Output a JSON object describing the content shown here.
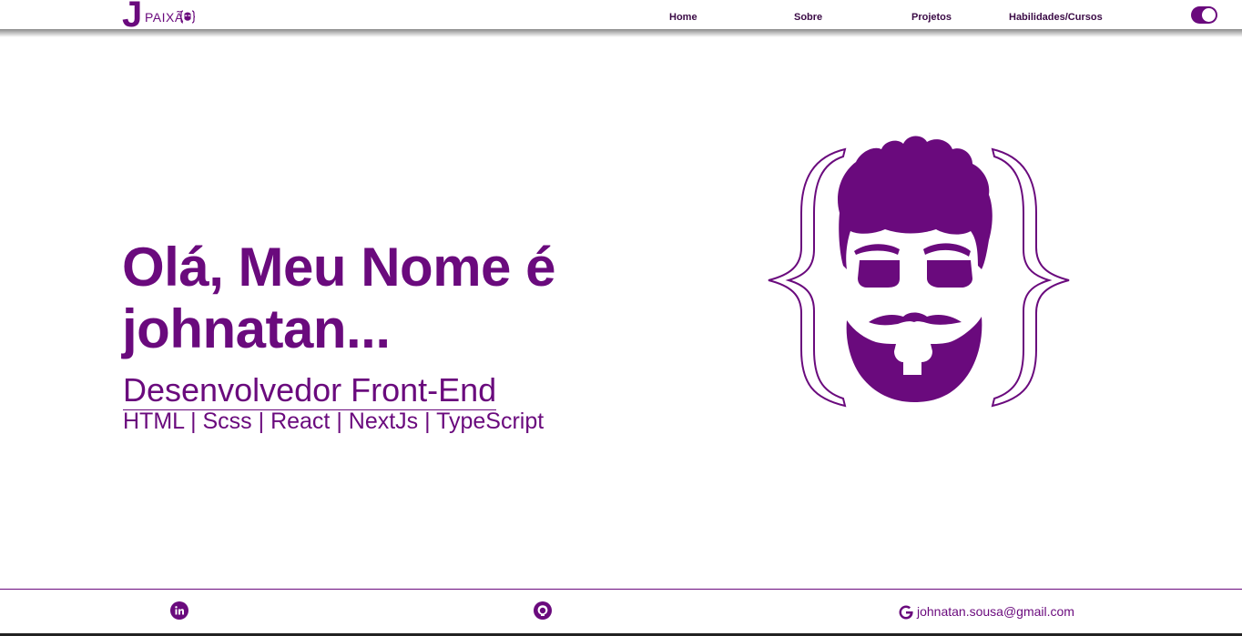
{
  "header": {
    "logo_letter": "J",
    "logo_text": "PAIXÃ",
    "nav": [
      {
        "label": "Home"
      },
      {
        "label": "Sobre"
      },
      {
        "label": "Projetos"
      },
      {
        "label": "Habilidades/Cursos"
      }
    ],
    "theme_toggle_icon": "moon-toggle-icon"
  },
  "hero": {
    "title": "Olá, Meu Nome é johnatan...",
    "subtitle": "Desenvolvedor Front-End",
    "stack": "HTML | Scss | React | NextJs | TypeScript",
    "avatar_icon": "bearded-face-braces-icon"
  },
  "footer": {
    "linkedin_icon": "linkedin-icon",
    "github_icon": "github-icon",
    "google_icon": "google-icon",
    "email": "johnatan.sousa@gmail.com"
  },
  "colors": {
    "accent": "#6a0a7d",
    "nav_text": "#3a0a45",
    "background": "#ffffff"
  }
}
